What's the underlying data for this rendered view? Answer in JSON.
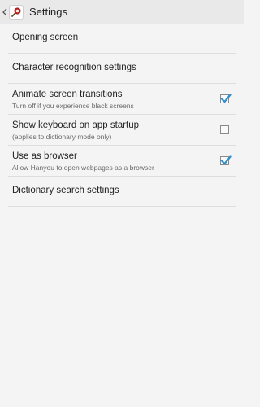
{
  "app_bar": {
    "title": "Settings",
    "back_icon": "chevron-left-icon",
    "app_icon": "hanyou-app-icon"
  },
  "colors": {
    "check_accent": "#2e8fd0",
    "divider": "#dedede",
    "background": "#f4f4f4"
  },
  "items": [
    {
      "type": "simple",
      "label": "Opening screen"
    },
    {
      "type": "simple",
      "label": "Character recognition settings"
    },
    {
      "type": "checkbox",
      "title": "Animate screen transitions",
      "subtitle": "Turn off if you experience black screens",
      "checked": true
    },
    {
      "type": "checkbox",
      "title": "Show keyboard on app startup",
      "subtitle": "(applies to dictionary mode only)",
      "checked": false
    },
    {
      "type": "checkbox",
      "title": "Use as browser",
      "subtitle": "Allow Hanyou to open webpages as a browser",
      "checked": true
    },
    {
      "type": "simple",
      "label": "Dictionary search settings"
    }
  ]
}
